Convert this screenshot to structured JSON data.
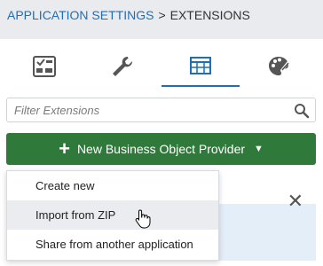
{
  "breadcrumb": {
    "parent": "APPLICATION SETTINGS",
    "separator": ">",
    "current": "EXTENSIONS"
  },
  "tabs": [
    {
      "icon": "settings-panel-icon",
      "active": false
    },
    {
      "icon": "wrench-icon",
      "active": false
    },
    {
      "icon": "table-grid-icon",
      "active": true
    },
    {
      "icon": "palette-icon",
      "active": false
    }
  ],
  "search": {
    "placeholder": "Filter Extensions",
    "value": "",
    "icon": "search-icon"
  },
  "primary_button": {
    "label": "New Business Object Provider",
    "icon": "plus-icon",
    "color": "#2f7a3a"
  },
  "dropdown": {
    "items": [
      {
        "label": "Create new"
      },
      {
        "label": "Import from ZIP"
      },
      {
        "label": "Share from another application"
      }
    ],
    "hovered_index": 1
  },
  "colors": {
    "accent": "#1f6fb6",
    "header_bg": "#e9ebee",
    "button_green": "#2f7a3a"
  }
}
